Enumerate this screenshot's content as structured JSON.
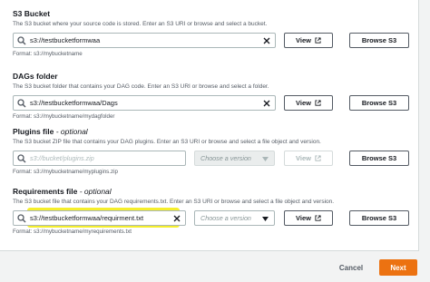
{
  "s3_bucket": {
    "label": "S3 Bucket",
    "description": "The S3 bucket where your source code is stored. Enter an S3 URI or browse and select a bucket.",
    "value": "s3://testbucketformwaa",
    "view_label": "View",
    "browse_label": "Browse S3",
    "format": "Format: s3://mybucketname"
  },
  "dags_folder": {
    "label": "DAGs folder",
    "description": "The S3 bucket folder that contains your DAG code. Enter an S3 URI or browse and select a folder.",
    "value": "s3://testbucketformwaa/Dags",
    "view_label": "View",
    "browse_label": "Browse S3",
    "format": "Format: s3://mybucketname/mydagfolder"
  },
  "plugins_file": {
    "label": "Plugins file",
    "optional_label": "- optional",
    "description": "The S3 bucket ZIP file that contains your DAG plugins. Enter an S3 URI or browse and select a file object and version.",
    "placeholder": "s3://bucket/plugins.zip",
    "version_placeholder": "Choose a version",
    "view_label": "View",
    "browse_label": "Browse S3",
    "format": "Format: s3://mybucketname/myplugins.zip"
  },
  "requirements_file": {
    "label": "Requirements file",
    "optional_label": "- optional",
    "description": "The S3 bucket file that contains your DAG requirements.txt. Enter an S3 URI or browse and select a file object and version.",
    "value": "s3://testbucketformwaa/requirment.txt",
    "version_placeholder": "Choose a version",
    "view_label": "View",
    "browse_label": "Browse S3",
    "format": "Format: s3://mybucketname/myrequirements.txt",
    "highlight_color": "#f5ee2c"
  },
  "footer": {
    "cancel_label": "Cancel",
    "next_label": "Next",
    "next_color": "#ec7211"
  }
}
